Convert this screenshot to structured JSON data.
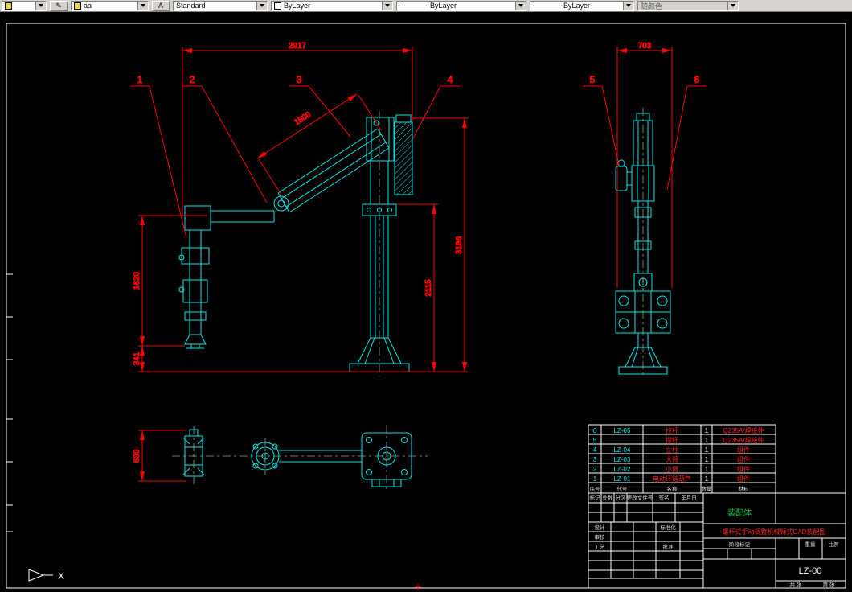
{
  "toolbar": {
    "view_combo": "",
    "edit_button_icon": "✎",
    "layer_combo": "aa",
    "style_button_icon": "A",
    "text_style_combo": "Standard",
    "color_combo": "ByLayer",
    "linetype_combo": "ByLayer",
    "lineweight_combo": "ByLayer",
    "plotstyle_combo": "随颜色"
  },
  "colors": {
    "geometry": "#00e8e8",
    "dimension": "#ff0000",
    "frame": "#ffffff",
    "title_green": "#17c23c",
    "toolbar_bg": "#d6d3ce"
  },
  "dim_labels": {
    "d2917": "2917",
    "d1500": "1500",
    "d703": "703",
    "d3186": "3186",
    "d2115": "2115",
    "d1620": "1620",
    "d341": "341",
    "d630": "630"
  },
  "balloons": [
    "1",
    "2",
    "3",
    "4",
    "5",
    "6"
  ],
  "parts_table": {
    "headers": {
      "no": "序号",
      "code": "代号",
      "name": "名称",
      "qty": "数量",
      "material": "材料"
    },
    "rows": [
      {
        "no": "6",
        "code": "LZ-05",
        "name": "拉杆",
        "qty": "1",
        "material": "Q235A/焊接件"
      },
      {
        "no": "5",
        "code": "",
        "name": "撑杆",
        "qty": "1",
        "material": "Q235A/焊接件"
      },
      {
        "no": "4",
        "code": "LZ-04",
        "name": "立柱",
        "qty": "1",
        "material": "组件"
      },
      {
        "no": "3",
        "code": "LZ-03",
        "name": "大臂",
        "qty": "1",
        "material": "组件"
      },
      {
        "no": "2",
        "code": "LZ-02",
        "name": "小臂",
        "qty": "1",
        "material": "组件"
      },
      {
        "no": "1",
        "code": "LZ-01",
        "name": "电动环链葫芦",
        "qty": "1",
        "material": "组件"
      }
    ]
  },
  "title_block": {
    "product_name": "装配体",
    "drawing_title": "螺杆式手动调整机械臂式CAD装配图",
    "drawing_no": "LZ-00",
    "labels": {
      "mark": "标记",
      "count": "处数",
      "zone": "分区",
      "change_doc": "更改文件号",
      "sign": "签名",
      "date": "年月日",
      "design": "设计",
      "check": "审核",
      "process": "工艺",
      "standard": "标准化",
      "approve": "批准",
      "stage_mark": "阶段标记",
      "weight": "重量",
      "scale": "比例",
      "sheet": "共 张",
      "page": "第 张"
    }
  },
  "ucs": {
    "axis_label": "X"
  }
}
